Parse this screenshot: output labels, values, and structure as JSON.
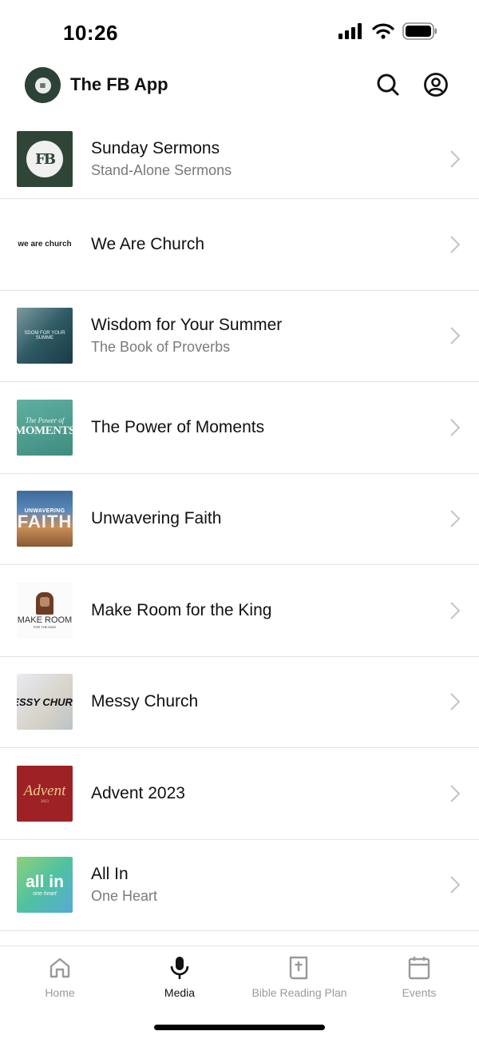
{
  "status_bar": {
    "time": "10:26"
  },
  "header": {
    "app_title": "The FB App"
  },
  "series": [
    {
      "title": "Sunday Sermons",
      "subtitle": "Stand-Alone Sermons",
      "thumb": {
        "text": "FB"
      }
    },
    {
      "title": "We Are Church",
      "subtitle": "",
      "thumb": {
        "text": "we are church"
      }
    },
    {
      "title": "Wisdom for Your Summer",
      "subtitle": "The Book of Proverbs",
      "thumb": {
        "text": "SDOM FOR YOUR SUMME"
      }
    },
    {
      "title": "The Power of Moments",
      "subtitle": "",
      "thumb": {
        "text_small": "The Power of",
        "text_big": "MOMENTS"
      }
    },
    {
      "title": "Unwavering Faith",
      "subtitle": "",
      "thumb": {
        "text_small": "UNWAVERING",
        "text_big": "FAITH"
      }
    },
    {
      "title": "Make Room for the King",
      "subtitle": "",
      "thumb": {
        "text_big": "MAKE ROOM",
        "text_small": "FOR THE KING"
      }
    },
    {
      "title": "Messy Church",
      "subtitle": "",
      "thumb": {
        "text": "IESSY CHURC"
      }
    },
    {
      "title": "Advent 2023",
      "subtitle": "",
      "thumb": {
        "text_big": "Advent",
        "text_small": "2023"
      }
    },
    {
      "title": "All In",
      "subtitle": "One Heart",
      "thumb": {
        "text_big": "all in",
        "text_small": "one heart"
      }
    }
  ],
  "tabs": [
    {
      "label": "Home",
      "icon": "home-icon",
      "active": false
    },
    {
      "label": "Media",
      "icon": "microphone-icon",
      "active": true
    },
    {
      "label": "Bible Reading Plan",
      "icon": "bible-icon",
      "active": false
    },
    {
      "label": "Events",
      "icon": "calendar-icon",
      "active": false
    }
  ],
  "colors": {
    "brand": "#2c4236",
    "active_tab": "#111111",
    "inactive_tab": "#9a9a9a"
  }
}
